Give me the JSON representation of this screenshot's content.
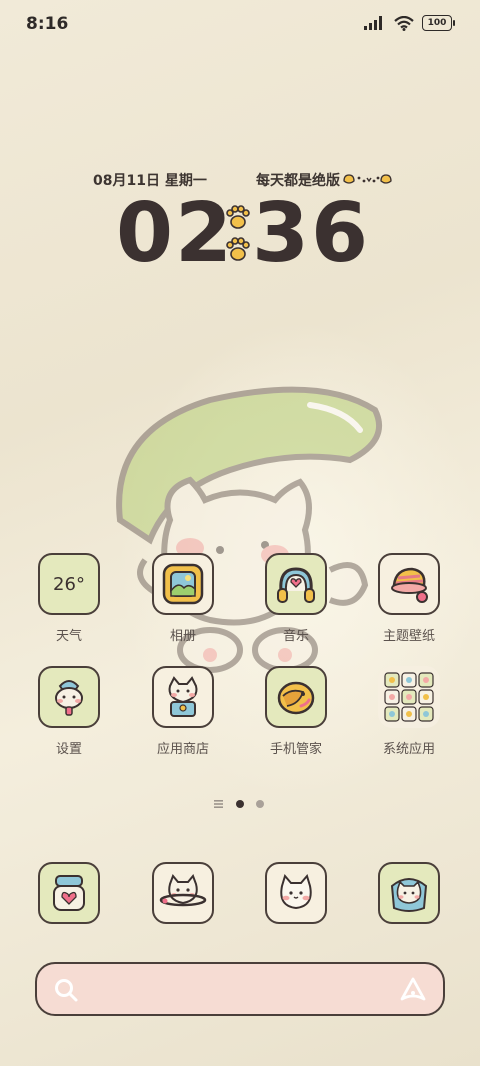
{
  "status_bar": {
    "time": "8:16",
    "battery": "100",
    "icons": [
      "signal-icon",
      "wifi-icon",
      "battery-icon"
    ]
  },
  "widget": {
    "date": "08月11日  星期一",
    "motto": "每天都是绝版",
    "clock_hours": "02",
    "clock_minutes": "36"
  },
  "apps": [
    {
      "label": "天气",
      "temp": "26°",
      "icon": "weather-icon"
    },
    {
      "label": "相册",
      "icon": "gallery-icon"
    },
    {
      "label": "音乐",
      "icon": "headphones-icon"
    },
    {
      "label": "主题壁纸",
      "icon": "theme-icon"
    },
    {
      "label": "设置",
      "icon": "settings-icon"
    },
    {
      "label": "应用商店",
      "icon": "app-store-icon"
    },
    {
      "label": "手机管家",
      "icon": "phone-manager-icon"
    },
    {
      "label": "系统应用",
      "icon": "system-apps-folder-icon"
    }
  ],
  "dock": [
    "phone-icon",
    "messages-icon",
    "camera-icon",
    "browser-icon"
  ],
  "page_indicator": {
    "pages": 3,
    "active": 1
  },
  "search": {
    "icons": [
      "search-icon",
      "assistant-icon"
    ]
  },
  "colors": {
    "background": "#ebe3cf",
    "green": "#e4e9bd",
    "pink": "#f6dcd3",
    "outline": "#4a3f3a"
  }
}
